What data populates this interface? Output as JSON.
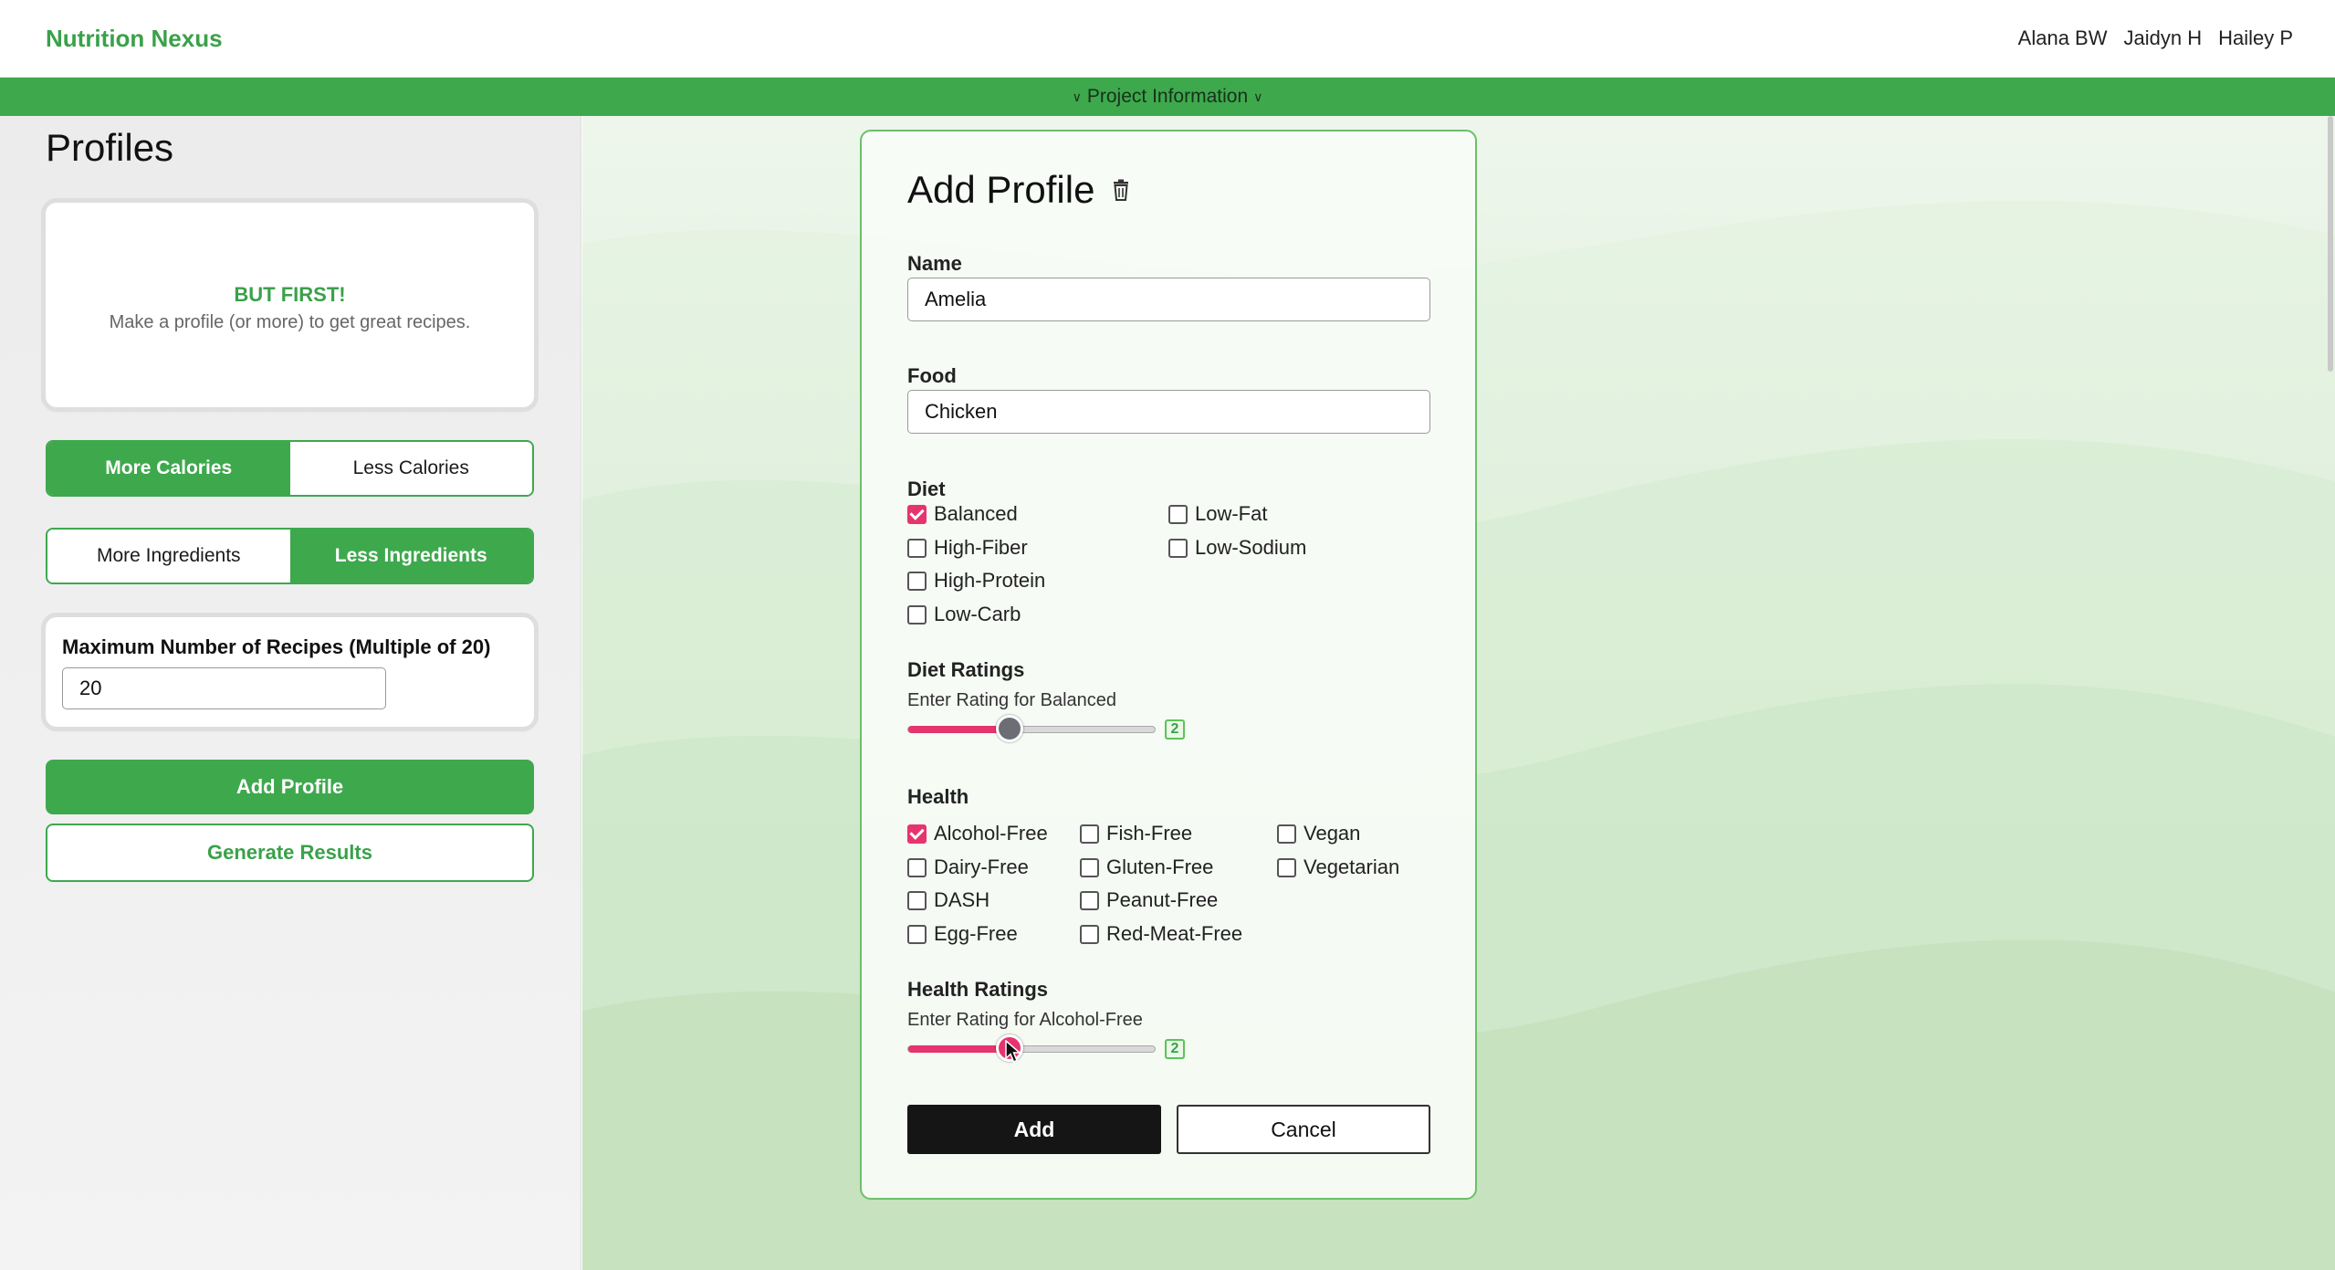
{
  "header": {
    "brand": "Nutrition Nexus",
    "team": [
      "Alana BW",
      "Jaidyn H",
      "Hailey P"
    ],
    "banner": "Project Information"
  },
  "sidebar": {
    "title": "Profiles",
    "notice_heading": "BUT FIRST!",
    "notice_text": "Make a profile (or more) to get great recipes.",
    "calories_toggle": {
      "left": "More Calories",
      "right": "Less Calories",
      "selected": "left"
    },
    "ingredients_toggle": {
      "left": "More Ingredients",
      "right": "Less Ingredients",
      "selected": "right"
    },
    "max_recipes_label": "Maximum Number of Recipes (Multiple of 20)",
    "max_recipes_value": "20",
    "add_profile_label": "Add Profile",
    "generate_label": "Generate Results"
  },
  "form": {
    "title": "Add Profile",
    "name_label": "Name",
    "name_value": "Amelia",
    "food_label": "Food",
    "food_value": "Chicken",
    "diet_label": "Diet",
    "diet_options": [
      {
        "label": "Balanced",
        "checked": true
      },
      {
        "label": "High-Fiber",
        "checked": false
      },
      {
        "label": "High-Protein",
        "checked": false
      },
      {
        "label": "Low-Carb",
        "checked": false
      },
      {
        "label": "Low-Fat",
        "checked": false
      },
      {
        "label": "Low-Sodium",
        "checked": false
      }
    ],
    "diet_ratings_label": "Diet Ratings",
    "diet_rating_prompt": "Enter Rating for Balanced",
    "diet_rating_value": "2",
    "health_label": "Health",
    "health_options": [
      {
        "label": "Alcohol-Free",
        "checked": true
      },
      {
        "label": "Dairy-Free",
        "checked": false
      },
      {
        "label": "DASH",
        "checked": false
      },
      {
        "label": "Egg-Free",
        "checked": false
      },
      {
        "label": "Fish-Free",
        "checked": false
      },
      {
        "label": "Gluten-Free",
        "checked": false
      },
      {
        "label": "Peanut-Free",
        "checked": false
      },
      {
        "label": "Red-Meat-Free",
        "checked": false
      },
      {
        "label": "Vegan",
        "checked": false
      },
      {
        "label": "Vegetarian",
        "checked": false
      }
    ],
    "health_ratings_label": "Health Ratings",
    "health_rating_prompt": "Enter Rating for Alcohol-Free",
    "health_rating_value": "2",
    "add_button": "Add",
    "cancel_button": "Cancel"
  },
  "colors": {
    "brand_green": "#3ea84d",
    "accent_pink": "#e6346f"
  },
  "icons": [
    "trash-icon",
    "caret-down-icon",
    "checkmark-icon",
    "mouse-pointer-icon"
  ]
}
